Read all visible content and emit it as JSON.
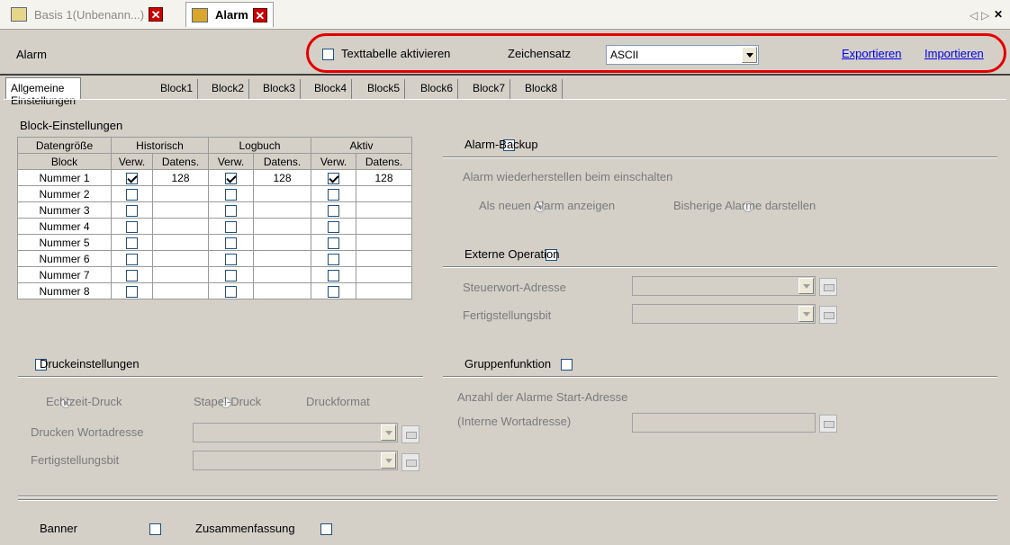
{
  "doc_tabs": [
    {
      "label": "Basis 1(Unbenann...)",
      "active": false
    },
    {
      "label": "Alarm",
      "active": true
    }
  ],
  "window_controls": {
    "prev": "◁",
    "next": "▷",
    "close": "✕"
  },
  "toolbar": {
    "title": "Alarm",
    "texttable_label": "Texttabelle aktivieren",
    "charset_label": "Zeichensatz",
    "charset_value": "ASCII",
    "export_label": "Exportieren",
    "import_label": "Importieren",
    "highlight_color": "#e30000"
  },
  "sub_tabs": [
    "Allgemeine Einstellungen",
    "Block1",
    "Block2",
    "Block3",
    "Block4",
    "Block5",
    "Block6",
    "Block7",
    "Block8"
  ],
  "block_settings": {
    "title": "Block-Einstellungen",
    "header_groups": [
      "Datengröße",
      "Historisch",
      "Logbuch",
      "Aktiv"
    ],
    "header_cols": [
      "Block",
      "Verw.",
      "Datens.",
      "Verw.",
      "Datens.",
      "Verw.",
      "Datens."
    ],
    "rows": [
      {
        "name": "Nummer 1",
        "hist": true,
        "hist_val": "128",
        "log": true,
        "log_val": "128",
        "act": true,
        "act_val": "128"
      },
      {
        "name": "Nummer 2",
        "hist": false,
        "hist_val": "",
        "log": false,
        "log_val": "",
        "act": false,
        "act_val": ""
      },
      {
        "name": "Nummer 3",
        "hist": false,
        "hist_val": "",
        "log": false,
        "log_val": "",
        "act": false,
        "act_val": ""
      },
      {
        "name": "Nummer 4",
        "hist": false,
        "hist_val": "",
        "log": false,
        "log_val": "",
        "act": false,
        "act_val": ""
      },
      {
        "name": "Nummer 5",
        "hist": false,
        "hist_val": "",
        "log": false,
        "log_val": "",
        "act": false,
        "act_val": ""
      },
      {
        "name": "Nummer 6",
        "hist": false,
        "hist_val": "",
        "log": false,
        "log_val": "",
        "act": false,
        "act_val": ""
      },
      {
        "name": "Nummer 7",
        "hist": false,
        "hist_val": "",
        "log": false,
        "log_val": "",
        "act": false,
        "act_val": ""
      },
      {
        "name": "Nummer 8",
        "hist": false,
        "hist_val": "",
        "log": false,
        "log_val": "",
        "act": false,
        "act_val": ""
      }
    ]
  },
  "print": {
    "title": "Druckeinstellungen",
    "realtime": "Echtzeit-Druck",
    "batch": "Stapel-Druck",
    "format": "Druckformat",
    "word_addr": "Drucken Wortadresse",
    "done_bit": "Fertigstellungsbit"
  },
  "alarm_backup": {
    "title": "Alarm-Backup",
    "restore": "Alarm wiederherstellen beim einschalten",
    "opt_new": "Als neuen Alarm anzeigen",
    "opt_prev": "Bisherige Alarme darstellen"
  },
  "external": {
    "title": "Externe Operation",
    "ctrl_word": "Steuerwort-Adresse",
    "done_bit": "Fertigstellungsbit"
  },
  "group": {
    "title": "Gruppenfunktion",
    "count_label": "Anzahl der Alarme Start-Adresse",
    "internal_label": "(Interne Wortadresse)"
  },
  "footer": {
    "banner": "Banner",
    "summary": "Zusammenfassung"
  }
}
